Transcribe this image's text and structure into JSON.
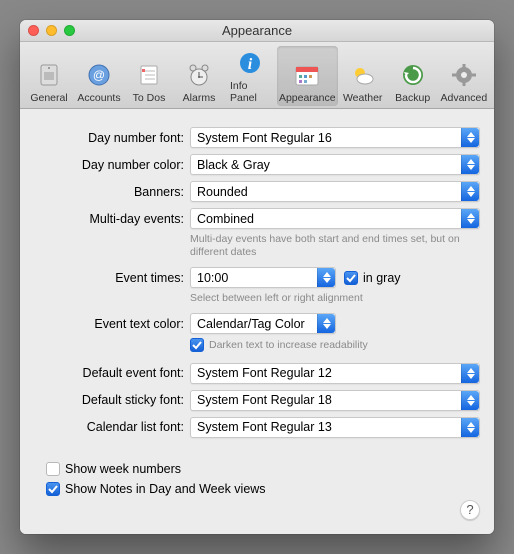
{
  "window": {
    "title": "Appearance"
  },
  "toolbar": {
    "items": [
      {
        "label": "General"
      },
      {
        "label": "Accounts"
      },
      {
        "label": "To Dos"
      },
      {
        "label": "Alarms"
      },
      {
        "label": "Info Panel"
      },
      {
        "label": "Appearance"
      },
      {
        "label": "Weather"
      },
      {
        "label": "Backup"
      },
      {
        "label": "Advanced"
      }
    ]
  },
  "form": {
    "day_number_font": {
      "label": "Day number font:",
      "value": "System Font Regular 16"
    },
    "day_number_color": {
      "label": "Day number color:",
      "value": "Black & Gray"
    },
    "banners": {
      "label": "Banners:",
      "value": "Rounded"
    },
    "multi_day_events": {
      "label": "Multi-day events:",
      "value": "Combined",
      "help": "Multi-day events have both start and end times set, but on different dates"
    },
    "event_times": {
      "label": "Event times:",
      "value": "10:00",
      "in_gray_label": "in gray",
      "in_gray_checked": true,
      "help": "Select between left or right alignment"
    },
    "event_text_color": {
      "label": "Event text color:",
      "value": "Calendar/Tag Color",
      "darken_label": "Darken text to increase readability",
      "darken_checked": true
    },
    "default_event_font": {
      "label": "Default event font:",
      "value": "System Font Regular 12"
    },
    "default_sticky_font": {
      "label": "Default sticky font:",
      "value": "System Font Regular 18"
    },
    "calendar_list_font": {
      "label": "Calendar list font:",
      "value": "System Font Regular 13"
    }
  },
  "bottom": {
    "show_week_numbers": {
      "label": "Show week numbers",
      "checked": false
    },
    "show_notes": {
      "label": "Show Notes in Day and Week views",
      "checked": true
    }
  },
  "help_button": "?"
}
